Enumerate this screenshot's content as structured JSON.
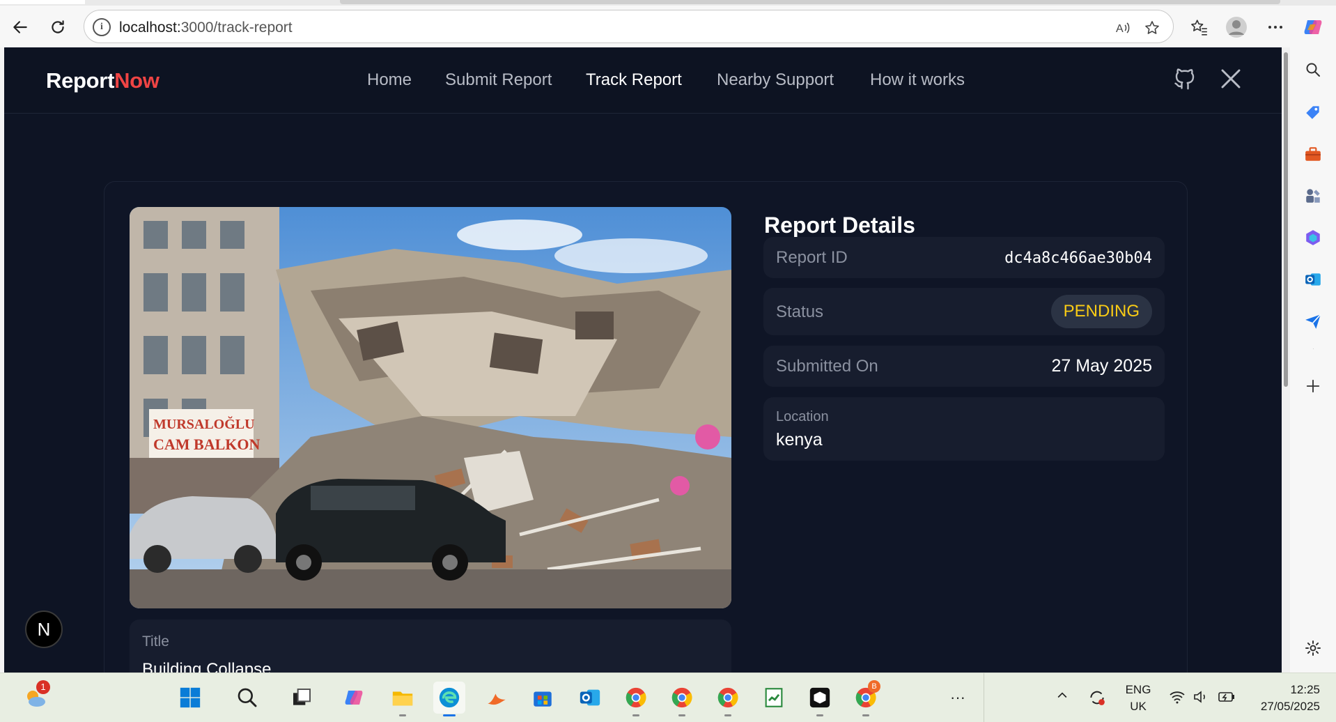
{
  "browser": {
    "url_host": "localhost:",
    "url_path": "3000/track-report",
    "info_glyph": "i"
  },
  "site": {
    "brand_primary": "Report",
    "brand_accent": "Now",
    "nav": [
      {
        "label": "Home"
      },
      {
        "label": "Submit Report"
      },
      {
        "label": "Track Report",
        "active": true
      },
      {
        "label": "Nearby Support"
      },
      {
        "label": "How it works"
      }
    ]
  },
  "report": {
    "details_title": "Report Details",
    "report_id_label": "Report ID",
    "report_id": "dc4a8c466ae30b04",
    "status_label": "Status",
    "status": "PENDING",
    "submitted_label": "Submitted On",
    "submitted_on": "27 May 2025",
    "location_label": "Location",
    "location": "kenya",
    "title_label": "Title",
    "title_value": "Building Collapse",
    "photo_sign_line1": "MURSALOĞLU",
    "photo_sign_line2": "CAM BALKON"
  },
  "dev_badge": "N",
  "taskbar": {
    "weather_badge": "1",
    "chrome_profile_badge": "B",
    "lang_line1": "ENG",
    "lang_line2": "UK",
    "time": "12:25",
    "date": "27/05/2025",
    "overflow": "···"
  },
  "colors": {
    "page_bg": "#0e1424",
    "brand_accent": "#ef4444",
    "status_pending": "#facc15"
  }
}
